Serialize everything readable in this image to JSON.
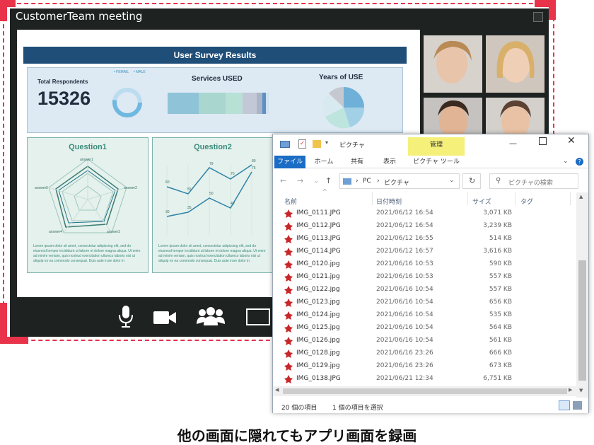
{
  "meeting": {
    "title": "CustomerTeam meeting",
    "slide": {
      "header": "User Survey Results",
      "total_label": "Total Respondents",
      "total_value": "15326",
      "legend_female": "• FEMAIL",
      "legend_male": "• MALE",
      "services_label": "Services USED",
      "years_label": "Years of USE",
      "q1_title": "Question1",
      "q2_title": "Question2",
      "radar_labels": [
        "answer1",
        "answer2",
        "answer3",
        "answer4",
        "answer5"
      ],
      "line_values_top": [
        "60",
        "55",
        "79",
        "70",
        "80"
      ],
      "line_values_bottom": [
        "30",
        "35",
        "50",
        "40",
        "75"
      ],
      "lorem": "Lorem ipsum dolor sit amet, consectetur adipiscing elit, sed do eiusmod tempor incididunt ut labore et dolore magna aliqua. Ut enim ad minim veniam, quis nostrud exercitation ullamco laboris nisi ut aliquip ex ea commodo consequat. Duis aute irure dolor in"
    },
    "toolbar": {
      "mic": "microphone-icon",
      "camera": "camera-icon",
      "participants": "participants-icon",
      "share": "screen-share-icon"
    }
  },
  "explorer": {
    "title": "ピクチャ",
    "manage_label": "管理",
    "tabs": [
      "ファイル",
      "ホーム",
      "共有",
      "表示",
      "ピクチャ ツール"
    ],
    "breadcrumb": [
      "PC",
      "ピクチャ"
    ],
    "search_placeholder": "ピクチャの検索",
    "columns": {
      "name": "名前",
      "date": "日付時刻",
      "size": "サイズ",
      "tag": "タグ"
    },
    "files": [
      {
        "name": "IMG_0111.JPG",
        "date": "2021/06/12 16:54",
        "size": "3,071 KB"
      },
      {
        "name": "IMG_0112.JPG",
        "date": "2021/06/12 16:54",
        "size": "3,239 KB"
      },
      {
        "name": "IMG_0113.JPG",
        "date": "2021/06/12 16:55",
        "size": "514 KB"
      },
      {
        "name": "IMG_0114.JPG",
        "date": "2021/06/12 16:57",
        "size": "3,616 KB"
      },
      {
        "name": "IMG_0120.jpg",
        "date": "2021/06/16 10:53",
        "size": "590 KB"
      },
      {
        "name": "IMG_0121.jpg",
        "date": "2021/06/16 10:53",
        "size": "557 KB"
      },
      {
        "name": "IMG_0122.jpg",
        "date": "2021/06/16 10:54",
        "size": "557 KB"
      },
      {
        "name": "IMG_0123.jpg",
        "date": "2021/06/16 10:54",
        "size": "656 KB"
      },
      {
        "name": "IMG_0124.jpg",
        "date": "2021/06/16 10:54",
        "size": "535 KB"
      },
      {
        "name": "IMG_0125.jpg",
        "date": "2021/06/16 10:54",
        "size": "564 KB"
      },
      {
        "name": "IMG_0126.jpg",
        "date": "2021/06/16 10:54",
        "size": "561 KB"
      },
      {
        "name": "IMG_0128.jpg",
        "date": "2021/06/16 23:26",
        "size": "666 KB"
      },
      {
        "name": "IMG_0129.jpg",
        "date": "2021/06/16 23:26",
        "size": "673 KB"
      },
      {
        "name": "IMG_0138.JPG",
        "date": "2021/06/21 12:34",
        "size": "6,751 KB"
      }
    ],
    "status_count": "20 個の項目",
    "status_selected": "1 個の項目を選択"
  },
  "caption": "他の画面に隠れてもアプリ画面を録画",
  "colors": {
    "record_frame": "#e8334a",
    "slide_header": "#1f4e79",
    "explorer_manage": "#f5f07a"
  }
}
